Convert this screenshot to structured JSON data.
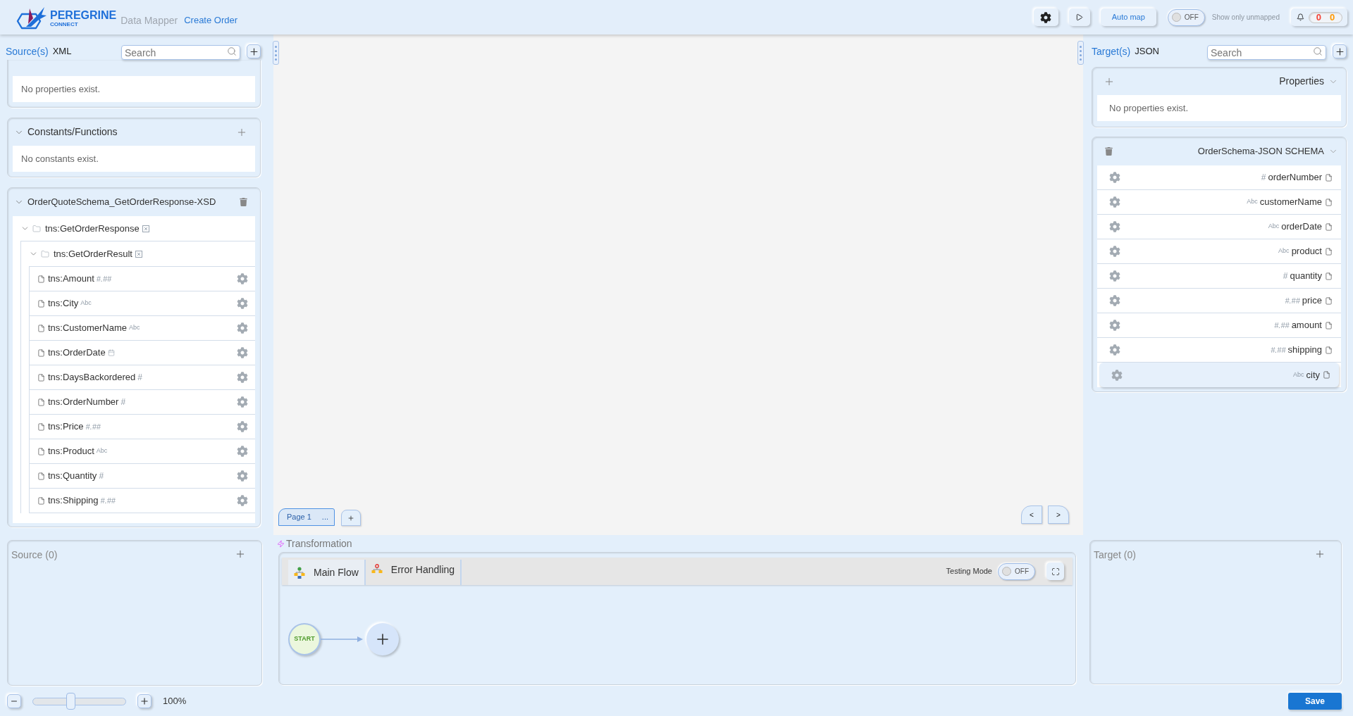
{
  "header": {
    "brand": "PEREGRINE",
    "brand_sub": "CONNECT",
    "app_name": "Data Mapper",
    "document": "Create Order",
    "auto_map": "Auto map",
    "unmapped_toggle": {
      "state_text": "OFF",
      "on": false
    },
    "unmapped_label": "Show only unmapped",
    "counts": [
      {
        "value": "0",
        "color": "#f44336"
      },
      {
        "value": "0",
        "color": "#ff9800"
      }
    ]
  },
  "source": {
    "title": "Source(s)",
    "format": "XML",
    "search": {
      "placeholder": "Search"
    },
    "properties": {
      "empty_text": "No properties exist."
    },
    "constants": {
      "title": "Constants/Functions",
      "expanded": true,
      "empty_text": "No constants exist."
    },
    "schema": {
      "title": "OrderQuoteSchema_GetOrderResponse-XSD",
      "expanded": true,
      "tree": [
        {
          "name": "tns:GetOrderResponse",
          "kind": "complex",
          "expanded": true,
          "children": [
            {
              "name": "tns:GetOrderResult",
              "kind": "complex",
              "expanded": true,
              "children": [
                {
                  "name": "tns:Amount",
                  "kind": "decimal",
                  "type_label": "#.##"
                },
                {
                  "name": "tns:City",
                  "kind": "string",
                  "type_label": "Abc"
                },
                {
                  "name": "tns:CustomerName",
                  "kind": "string",
                  "type_label": "Abc"
                },
                {
                  "name": "tns:OrderDate",
                  "kind": "date"
                },
                {
                  "name": "tns:DaysBackordered",
                  "kind": "integer",
                  "type_label": "#"
                },
                {
                  "name": "tns:OrderNumber",
                  "kind": "integer",
                  "type_label": "#"
                },
                {
                  "name": "tns:Price",
                  "kind": "decimal",
                  "type_label": "#.##"
                },
                {
                  "name": "tns:Product",
                  "kind": "string",
                  "type_label": "Abc"
                },
                {
                  "name": "tns:Quantity",
                  "kind": "integer",
                  "type_label": "#"
                },
                {
                  "name": "tns:Shipping",
                  "kind": "decimal",
                  "type_label": "#.##"
                }
              ]
            }
          ]
        }
      ]
    }
  },
  "canvas": {
    "pages": [
      {
        "label": "Page 1",
        "menu": "...",
        "selected": true
      }
    ],
    "nav": [
      "<",
      ">"
    ]
  },
  "target": {
    "title": "Target(s)",
    "format": "JSON",
    "search": {
      "placeholder": "Search"
    },
    "properties": {
      "title": "Properties",
      "expanded": true,
      "empty_text": "No properties exist."
    },
    "schema": {
      "title": "OrderSchema-JSON SCHEMA",
      "expanded": true,
      "fields": [
        {
          "name": "orderNumber",
          "kind": "integer",
          "type_label": "#",
          "selected": false
        },
        {
          "name": "customerName",
          "kind": "string",
          "type_label": "Abc",
          "selected": false
        },
        {
          "name": "orderDate",
          "kind": "string",
          "type_label": "Abc",
          "selected": false
        },
        {
          "name": "product",
          "kind": "string",
          "type_label": "Abc",
          "selected": false
        },
        {
          "name": "quantity",
          "kind": "integer",
          "type_label": "#",
          "selected": false
        },
        {
          "name": "price",
          "kind": "decimal",
          "type_label": "#.##",
          "selected": false
        },
        {
          "name": "amount",
          "kind": "decimal",
          "type_label": "#.##",
          "selected": false
        },
        {
          "name": "shipping",
          "kind": "decimal",
          "type_label": "#.##",
          "selected": false
        },
        {
          "name": "city",
          "kind": "string",
          "type_label": "Abc",
          "selected": true
        }
      ]
    }
  },
  "source_mappings": {
    "title": "Source (0)"
  },
  "transformation": {
    "title": "Transformation",
    "tabs": [
      {
        "label": "Main Flow",
        "selected": true
      },
      {
        "label": "Error Handling",
        "selected": false
      }
    ],
    "testing_mode": {
      "label": "Testing Mode",
      "state_text": "OFF",
      "on": false
    },
    "flow": {
      "start": "START"
    }
  },
  "target_mappings": {
    "title": "Target (0)"
  },
  "footer": {
    "zoom": {
      "level": 0.4,
      "reading": "100%"
    },
    "save": "Save"
  }
}
